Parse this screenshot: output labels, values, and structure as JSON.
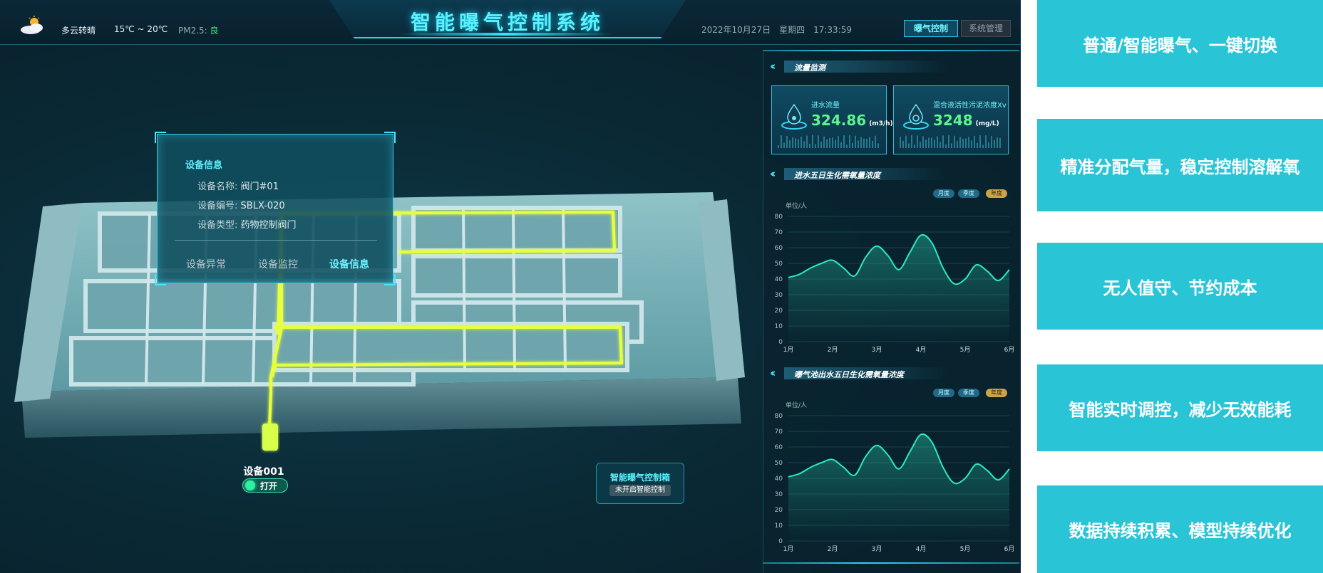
{
  "header": {
    "weather": "多云转晴",
    "temperature": "15℃ ~ 20℃",
    "pm_label": "PM2.5:",
    "pm_value": "良",
    "title": "智能曝气控制系统",
    "datetime": "2022年10月27日　星期四　17:33:59",
    "tabs": [
      {
        "label": "曝气控制",
        "active": true
      },
      {
        "label": "系统管理",
        "active": false
      }
    ]
  },
  "info_popup": {
    "title": "设备信息",
    "rows": [
      {
        "label": "设备名称:",
        "value": "阀门#01"
      },
      {
        "label": "设备编号:",
        "value": "SBLX-020"
      },
      {
        "label": "设备类型:",
        "value": "药物控制阀门"
      }
    ],
    "tabs": [
      "设备异常",
      "设备监控",
      "设备信息"
    ]
  },
  "device": {
    "name": "设备001",
    "switch_label": "打开"
  },
  "control_box": {
    "title": "智能曝气控制箱",
    "status": "未开启智能控制"
  },
  "flow": {
    "section_title": "流量监测",
    "cards": [
      {
        "label": "进水流量",
        "value": "324.86",
        "unit": "(m3/h)"
      },
      {
        "label": "混合液活性污泥浓度Xv",
        "value": "3248",
        "unit": "(mg/L)"
      }
    ]
  },
  "chart_pills": [
    "月度",
    "季度",
    "年度"
  ],
  "chart_data": [
    {
      "type": "area",
      "title": "进水五日生化需氧量浓度",
      "ylabel": "单位/人",
      "categories": [
        "1月",
        "2月",
        "3月",
        "4月",
        "5月",
        "6月"
      ],
      "yticks": [
        0,
        10,
        20,
        30,
        40,
        50,
        60,
        70,
        80
      ],
      "ylim": [
        0,
        80
      ],
      "x": [
        0,
        0.25,
        0.5,
        0.75,
        1.0,
        1.25,
        1.5,
        1.75,
        2.0,
        2.25,
        2.5,
        2.75,
        3.0,
        3.25,
        3.5,
        3.75,
        4.0,
        4.25,
        4.5,
        4.75,
        5.0
      ],
      "values": [
        41,
        43,
        47,
        50,
        52,
        47,
        42,
        54,
        61,
        55,
        46,
        57,
        68,
        63,
        47,
        37,
        40,
        49,
        45,
        39,
        46
      ]
    },
    {
      "type": "area",
      "title": "曝气池出水五日生化需氧量浓度",
      "ylabel": "单位/人",
      "categories": [
        "1月",
        "2月",
        "3月",
        "4月",
        "5月",
        "6月"
      ],
      "yticks": [
        0,
        10,
        20,
        30,
        40,
        50,
        60,
        70,
        80
      ],
      "ylim": [
        0,
        80
      ],
      "x": [
        0,
        0.25,
        0.5,
        0.75,
        1.0,
        1.25,
        1.5,
        1.75,
        2.0,
        2.25,
        2.5,
        2.75,
        3.0,
        3.25,
        3.5,
        3.75,
        4.0,
        4.25,
        4.5,
        4.75,
        5.0
      ],
      "values": [
        41,
        43,
        47,
        50,
        52,
        47,
        42,
        54,
        61,
        55,
        46,
        57,
        68,
        63,
        47,
        37,
        40,
        49,
        45,
        39,
        46
      ]
    }
  ],
  "features": [
    "普通/智能曝气、一键切换",
    "精准分配气量，稳定控制溶解氧",
    "无人值守、节约成本",
    "智能实时调控，减少无效能耗",
    "数据持续积累、模型持续优化"
  ],
  "colors": {
    "accent": "#2ad4ef",
    "chart_line": "#2ee8c4",
    "value_green": "#5ef58e",
    "feature_bg": "#29c4d6",
    "pipe_yellow": "#e8ff3a"
  }
}
